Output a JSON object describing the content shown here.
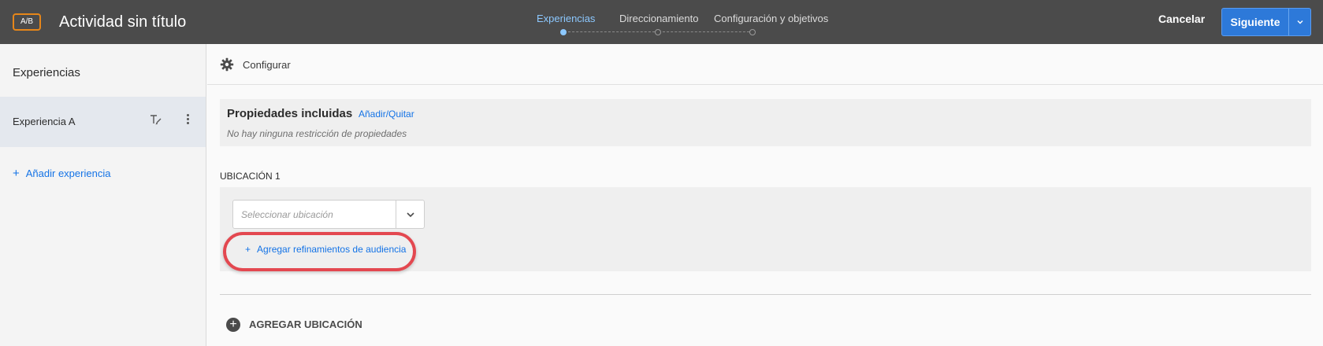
{
  "header": {
    "badge": "A/B",
    "title": "Actividad sin título",
    "steps": [
      {
        "label": "Experiencias",
        "active": true
      },
      {
        "label": "Direccionamiento",
        "active": false
      },
      {
        "label": "Configuración y objetivos",
        "active": false
      }
    ],
    "cancel_label": "Cancelar",
    "next_label": "Siguiente"
  },
  "sidebar": {
    "title": "Experiencias",
    "experiences": [
      {
        "label": "Experiencia A"
      }
    ],
    "add_label": "Añadir experiencia"
  },
  "main": {
    "config_label": "Configurar",
    "properties": {
      "title": "Propiedades incluidas",
      "link": "Añadir/Quitar",
      "note": "No hay ninguna restricción de propiedades"
    },
    "location": {
      "label": "UBICACIÓN 1",
      "select_placeholder": "Seleccionar ubicación",
      "refine_label": "Agregar refinamientos de audiencia"
    },
    "add_location_label": "AGREGAR UBICACIÓN"
  },
  "colors": {
    "topbar": "#4b4b4b",
    "accent": "#1473e6",
    "primary_button": "#2d79d9",
    "badge_border": "#e68619",
    "highlight": "#e34850"
  }
}
